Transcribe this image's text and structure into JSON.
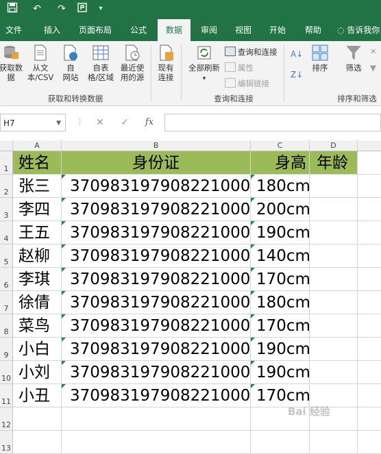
{
  "ribbon_tabs": [
    "文件",
    "插入",
    "页面布局",
    "公式",
    "数据",
    "审阅",
    "视图",
    "开始",
    "帮助"
  ],
  "active_tab": "数据",
  "tell_me": "告诉我你",
  "ribbon": {
    "get_data": "获取数\n据",
    "from_csv": "从文\n本/CSV",
    "from_web": "自\n网站",
    "from_table": "自表\n格/区域",
    "recent_sources": "最近使\n用的源",
    "existing_conn": "现有\n连接",
    "group_get_transform": "获取和转换数据",
    "refresh_all": "全部刷新",
    "queries_conn": "查询和连接",
    "properties": "属性",
    "edit_links": "编辑链接",
    "group_queries": "查询和连接",
    "sort": "排序",
    "filter": "筛选",
    "group_sort_filter": "排序和筛选"
  },
  "formula_bar": {
    "name_box": "H7",
    "cancel": "✕",
    "enter": "✓",
    "fx": "fx",
    "formula": ""
  },
  "columns": [
    "A",
    "B",
    "C",
    "D"
  ],
  "rows": [
    "1",
    "2",
    "3",
    "4",
    "5",
    "6",
    "7",
    "8",
    "9",
    "10",
    "11",
    "12",
    "13"
  ],
  "header_row": [
    "姓名",
    "身份证",
    "身高",
    "年龄"
  ],
  "table_rows": [
    [
      "张三",
      "370983197908221000",
      "180cm",
      ""
    ],
    [
      "李四",
      "370983197908221000",
      "200cm",
      ""
    ],
    [
      "王五",
      "370983197908221000",
      "190cm",
      ""
    ],
    [
      "赵柳",
      "370983197908221000",
      "140cm",
      ""
    ],
    [
      "李琪",
      "370983197908221000",
      "170cm",
      ""
    ],
    [
      "徐倩",
      "370983197908221000",
      "180cm",
      ""
    ],
    [
      "菜鸟",
      "370983197908221000",
      "170cm",
      ""
    ],
    [
      "小白",
      "370983197908221000",
      "190cm",
      ""
    ],
    [
      "小刘",
      "370983197908221000",
      "190cm",
      ""
    ],
    [
      "小丑",
      "370983197908221000",
      "170cm",
      ""
    ]
  ],
  "colors": {
    "excel_green": "#217346",
    "header_fill": "#9bbb59",
    "text_marker": "#1e8a3a"
  },
  "watermark": "Bai 经验"
}
